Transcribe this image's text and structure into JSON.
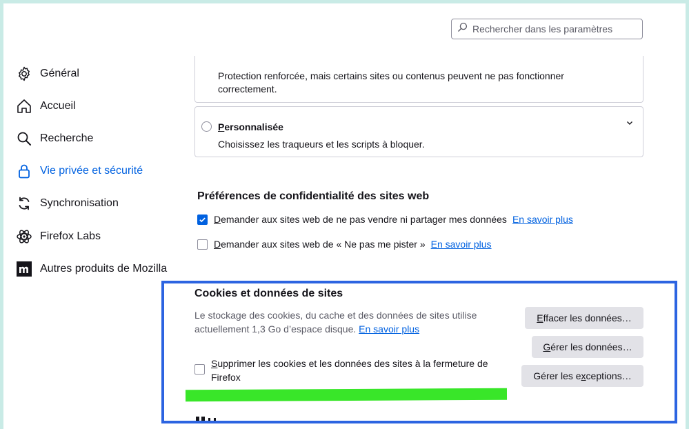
{
  "search": {
    "placeholder": "Rechercher dans les paramètres",
    "icon": "search-icon"
  },
  "sidebar": {
    "items": [
      {
        "label": "Général",
        "icon": "gear-icon",
        "active": false
      },
      {
        "label": "Accueil",
        "icon": "home-icon",
        "active": false
      },
      {
        "label": "Recherche",
        "icon": "search-icon",
        "active": false
      },
      {
        "label": "Vie privée et sécurité",
        "icon": "lock-icon",
        "active": true
      },
      {
        "label": "Synchronisation",
        "icon": "sync-icon",
        "active": false
      },
      {
        "label": "Firefox Labs",
        "icon": "flask-atom-icon",
        "active": false
      },
      {
        "label": "Autres produits de Mozilla",
        "icon": "mozilla-m-icon",
        "active": false
      }
    ]
  },
  "tracking": {
    "strict_desc": "Protection renforcée, mais certains sites ou contenus peuvent ne pas fonctionner correctement.",
    "custom_title_first": "P",
    "custom_title_rest": "ersonnalisée",
    "custom_desc": "Choisissez les traqueurs et les scripts à bloquer."
  },
  "privacy_prefs": {
    "heading": "Préférences de confidentialité des sites web",
    "dnsell": {
      "first": "D",
      "rest": "emander aux sites web de ne pas vendre ni partager mes données",
      "checked": true,
      "link": "En savoir plus"
    },
    "dnt": {
      "first": "D",
      "rest": "emander aux sites web de « Ne pas me pister »",
      "checked": false,
      "link": "En savoir plus"
    }
  },
  "cookies": {
    "heading": "Cookies et données de sites",
    "desc": "Le stockage des cookies, du cache et des données de sites utilise actuellement 1,3 Go d’espace disque.",
    "link": "En savoir plus",
    "btn_clear": {
      "first": "E",
      "rest": "ffacer les données…"
    },
    "btn_manage": {
      "first": "G",
      "rest": "érer les données…"
    },
    "btn_exceptions": {
      "pre": "Gérer les e",
      "accel": "x",
      "post": "ceptions…"
    },
    "delete_on_close": {
      "first": "S",
      "rest": "upprimer les cookies et les données des sites à la fermeture de Firefox",
      "checked": false
    }
  },
  "colors": {
    "accent": "#0061e0",
    "frame": "#2c64e1",
    "highlight": "#39e629",
    "background": "#c9ebe6"
  }
}
